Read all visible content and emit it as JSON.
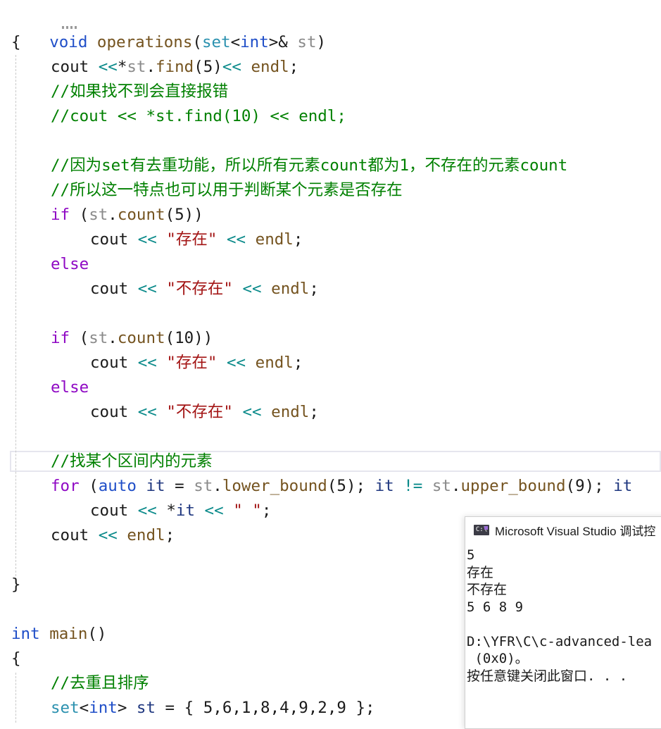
{
  "editor": {
    "lines": [
      {
        "t": "void operations(set<int>& st)"
      },
      {
        "t": "{"
      },
      {
        "t": "cout <<*st.find(5)<< endl;"
      },
      {
        "t": "//如果找不到会直接报错"
      },
      {
        "t": "//cout << *st.find(10) << endl;"
      },
      {
        "t": ""
      },
      {
        "t": "//因为set有去重功能，所以所有元素count都为1，不存在的元素count"
      },
      {
        "t": "//所以这一特点也可以用于判断某个元素是否存在"
      },
      {
        "t": "if (st.count(5))"
      },
      {
        "t": "cout << \"存在\" << endl;"
      },
      {
        "t": "else"
      },
      {
        "t": "cout << \"不存在\" << endl;"
      },
      {
        "t": ""
      },
      {
        "t": "if (st.count(10))"
      },
      {
        "t": "cout << \"存在\" << endl;"
      },
      {
        "t": "else"
      },
      {
        "t": "cout << \"不存在\" << endl;"
      },
      {
        "t": ""
      },
      {
        "t": "//找某个区间内的元素"
      },
      {
        "t": "for (auto it = st.lower_bound(5); it != st.upper_bound(9); it"
      },
      {
        "t": "cout << *it << \" \";"
      },
      {
        "t": "cout << endl;"
      },
      {
        "t": ""
      },
      {
        "t": "}"
      },
      {
        "t": ""
      },
      {
        "t": "int main()"
      },
      {
        "t": "{"
      },
      {
        "t": "//去重且排序"
      },
      {
        "t": "set<int> st = { 5,6,1,8,4,9,2,9 };"
      }
    ]
  },
  "console": {
    "title": "Microsoft Visual Studio 调试控",
    "icon": "console-app-icon",
    "output": [
      "5",
      "存在",
      "不存在",
      "5 6 8 9",
      "",
      "D:\\YFR\\C\\c-advanced-lea",
      " (0x0)。",
      "按任意键关闭此窗口. . ."
    ]
  },
  "colors": {
    "keyword": "#1f4ec8",
    "type": "#2b91af",
    "string": "#a31515",
    "comment": "#008000",
    "function": "#74531f"
  }
}
